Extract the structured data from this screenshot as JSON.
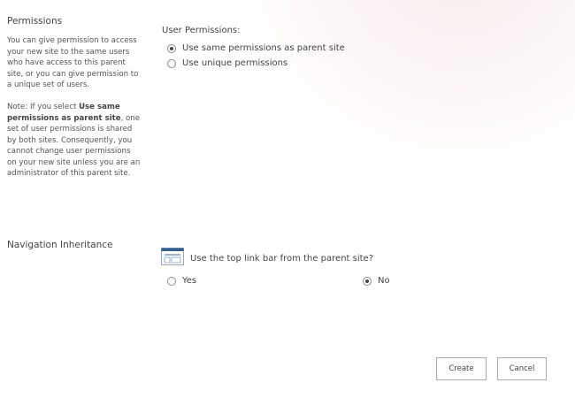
{
  "permissions": {
    "title": "Permissions",
    "description": "You can give permission to access your new site to the same users who have access to this parent site, or you can give permission to a unique set of users.",
    "note_prefix": "Note: If you select ",
    "note_bold": "Use same permissions as parent site",
    "note_suffix": ", one set of user permissions is shared by both sites. Consequently, you cannot change user permissions on your new site unless you are an administrator of this parent site.",
    "field_label": "User Permissions:",
    "options": [
      {
        "label": "Use same permissions as parent site",
        "checked": true
      },
      {
        "label": "Use unique permissions",
        "checked": false
      }
    ]
  },
  "navigation": {
    "title": "Navigation Inheritance",
    "icon": "top-link-bar-icon",
    "question": "Use the top link bar from the parent site?",
    "options": [
      {
        "label": "Yes",
        "checked": false
      },
      {
        "label": "No",
        "checked": true
      }
    ]
  },
  "buttons": {
    "create": "Create",
    "cancel": "Cancel"
  }
}
